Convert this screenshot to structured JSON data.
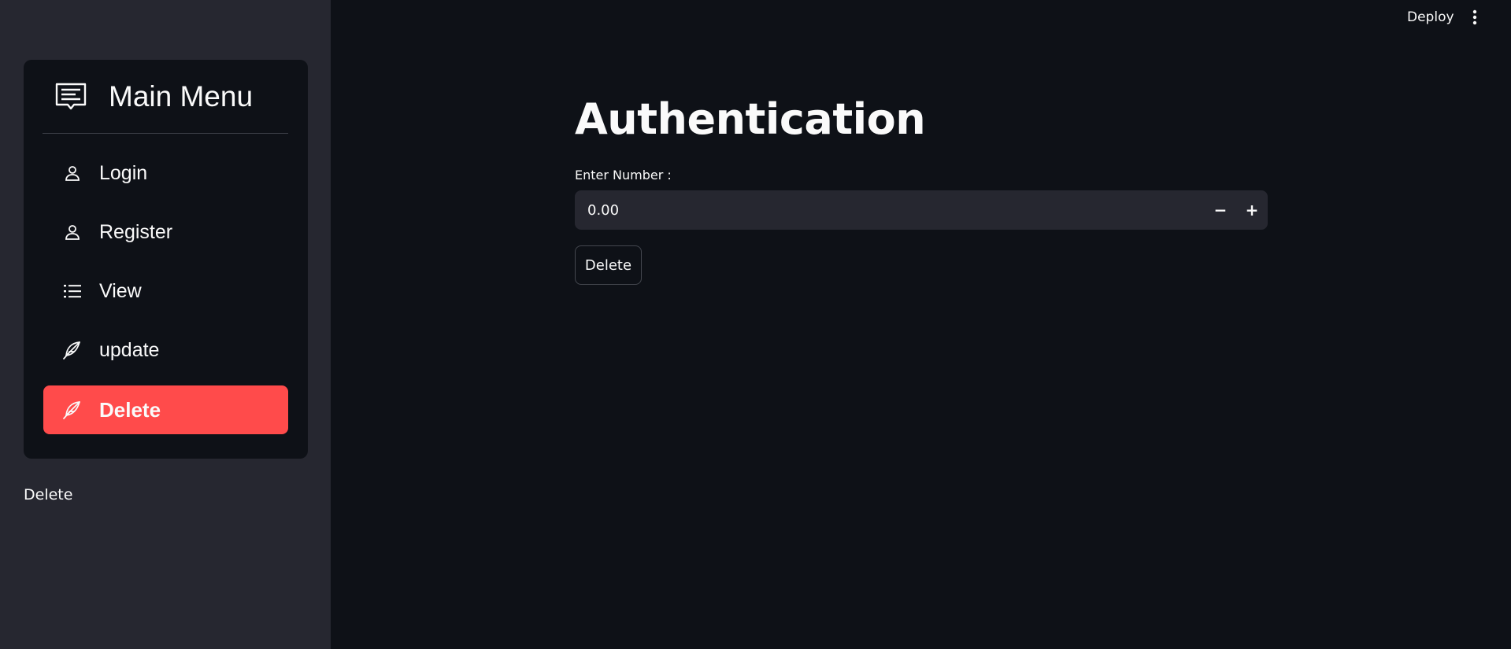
{
  "header": {
    "deploy_label": "Deploy",
    "menu_icon": "kebab-vertical-icon"
  },
  "sidebar": {
    "menu_title": "Main Menu",
    "menu_icon": "menu-list-icon",
    "items": [
      {
        "label": "Login",
        "icon": "person-icon",
        "active": false
      },
      {
        "label": "Register",
        "icon": "person-icon",
        "active": false
      },
      {
        "label": "View",
        "icon": "list-icon",
        "active": false
      },
      {
        "label": "update",
        "icon": "feather-icon",
        "active": false
      },
      {
        "label": "Delete",
        "icon": "feather-icon",
        "active": true
      }
    ],
    "caption": "Delete"
  },
  "main": {
    "title": "Authentication",
    "number_field": {
      "label": "Enter Number :",
      "value": "0.00",
      "decrement": "−",
      "increment": "+"
    },
    "delete_button": "Delete"
  },
  "colors": {
    "background": "#0e1117",
    "sidebar": "#262730",
    "accent": "#ff4b4b"
  }
}
